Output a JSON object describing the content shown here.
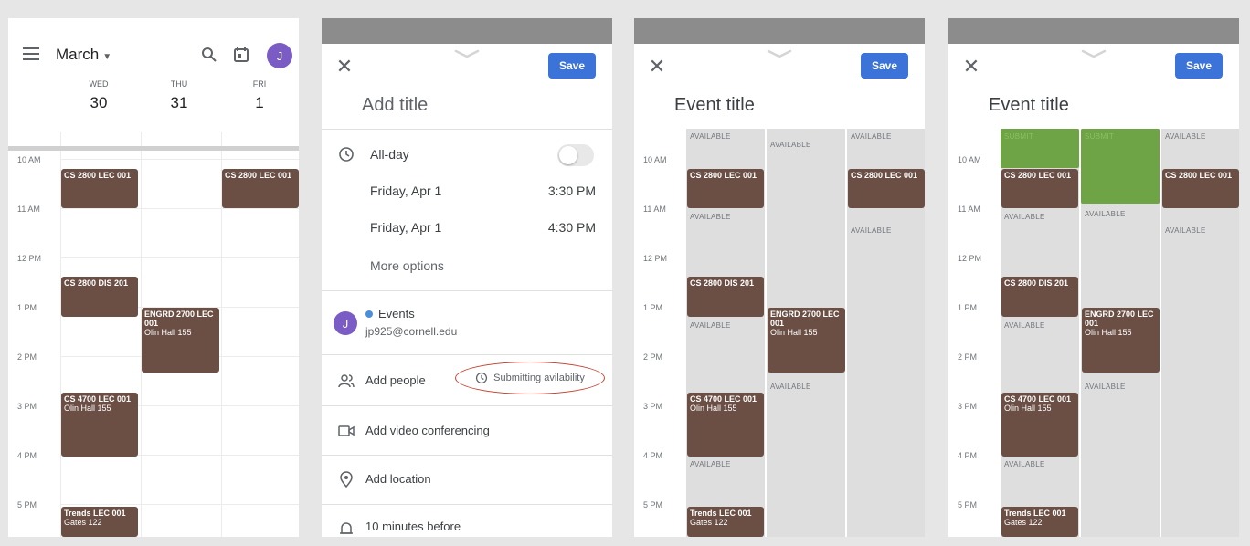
{
  "panel1": {
    "month": "March",
    "days": [
      {
        "name": "WED",
        "date": "30"
      },
      {
        "name": "THU",
        "date": "31"
      },
      {
        "name": "FRI",
        "date": "1"
      }
    ],
    "avatar": "J"
  },
  "times": [
    "10 AM",
    "11 AM",
    "12 PM",
    "1 PM",
    "2 PM",
    "3 PM",
    "4 PM",
    "5 PM"
  ],
  "events": {
    "cs2800_lec_wed": {
      "title": "CS 2800 LEC 001",
      "sub": ""
    },
    "cs2800_lec_fri": {
      "title": "CS 2800 LEC 001",
      "sub": ""
    },
    "cs2800_dis": {
      "title": "CS 2800 DIS 201",
      "sub": ""
    },
    "engrd": {
      "title": "ENGRD 2700 LEC 001",
      "sub": "Olin Hall 155"
    },
    "cs4700": {
      "title": "CS 4700 LEC 001",
      "sub": "Olin Hall 155"
    },
    "trends": {
      "title": "Trends LEC 001",
      "sub": "Gates 122"
    }
  },
  "panel2": {
    "save": "Save",
    "title_placeholder": "Add title",
    "allday": "All-day",
    "start_date": "Friday, Apr 1",
    "start_time": "3:30 PM",
    "end_date": "Friday, Apr 1",
    "end_time": "4:30 PM",
    "more_options": "More options",
    "calendar_name": "Events",
    "calendar_email": "jp925@cornell.edu",
    "avatar": "J",
    "add_people": "Add people",
    "submitting": "Submitting avilability",
    "video": "Add video conferencing",
    "location": "Add location",
    "notification": "10 minutes before"
  },
  "panel3": {
    "save": "Save",
    "title": "Event title"
  },
  "panel4": {
    "save": "Save",
    "title": "Event title"
  },
  "labels": {
    "available": "AVAILABLE",
    "submit": "SUBMIT"
  },
  "colors": {
    "event": "#6b4f45",
    "save": "#3b73d8",
    "submit": "#6ea346",
    "available_col": "#dedede",
    "avatar": "#7b5cc4"
  }
}
